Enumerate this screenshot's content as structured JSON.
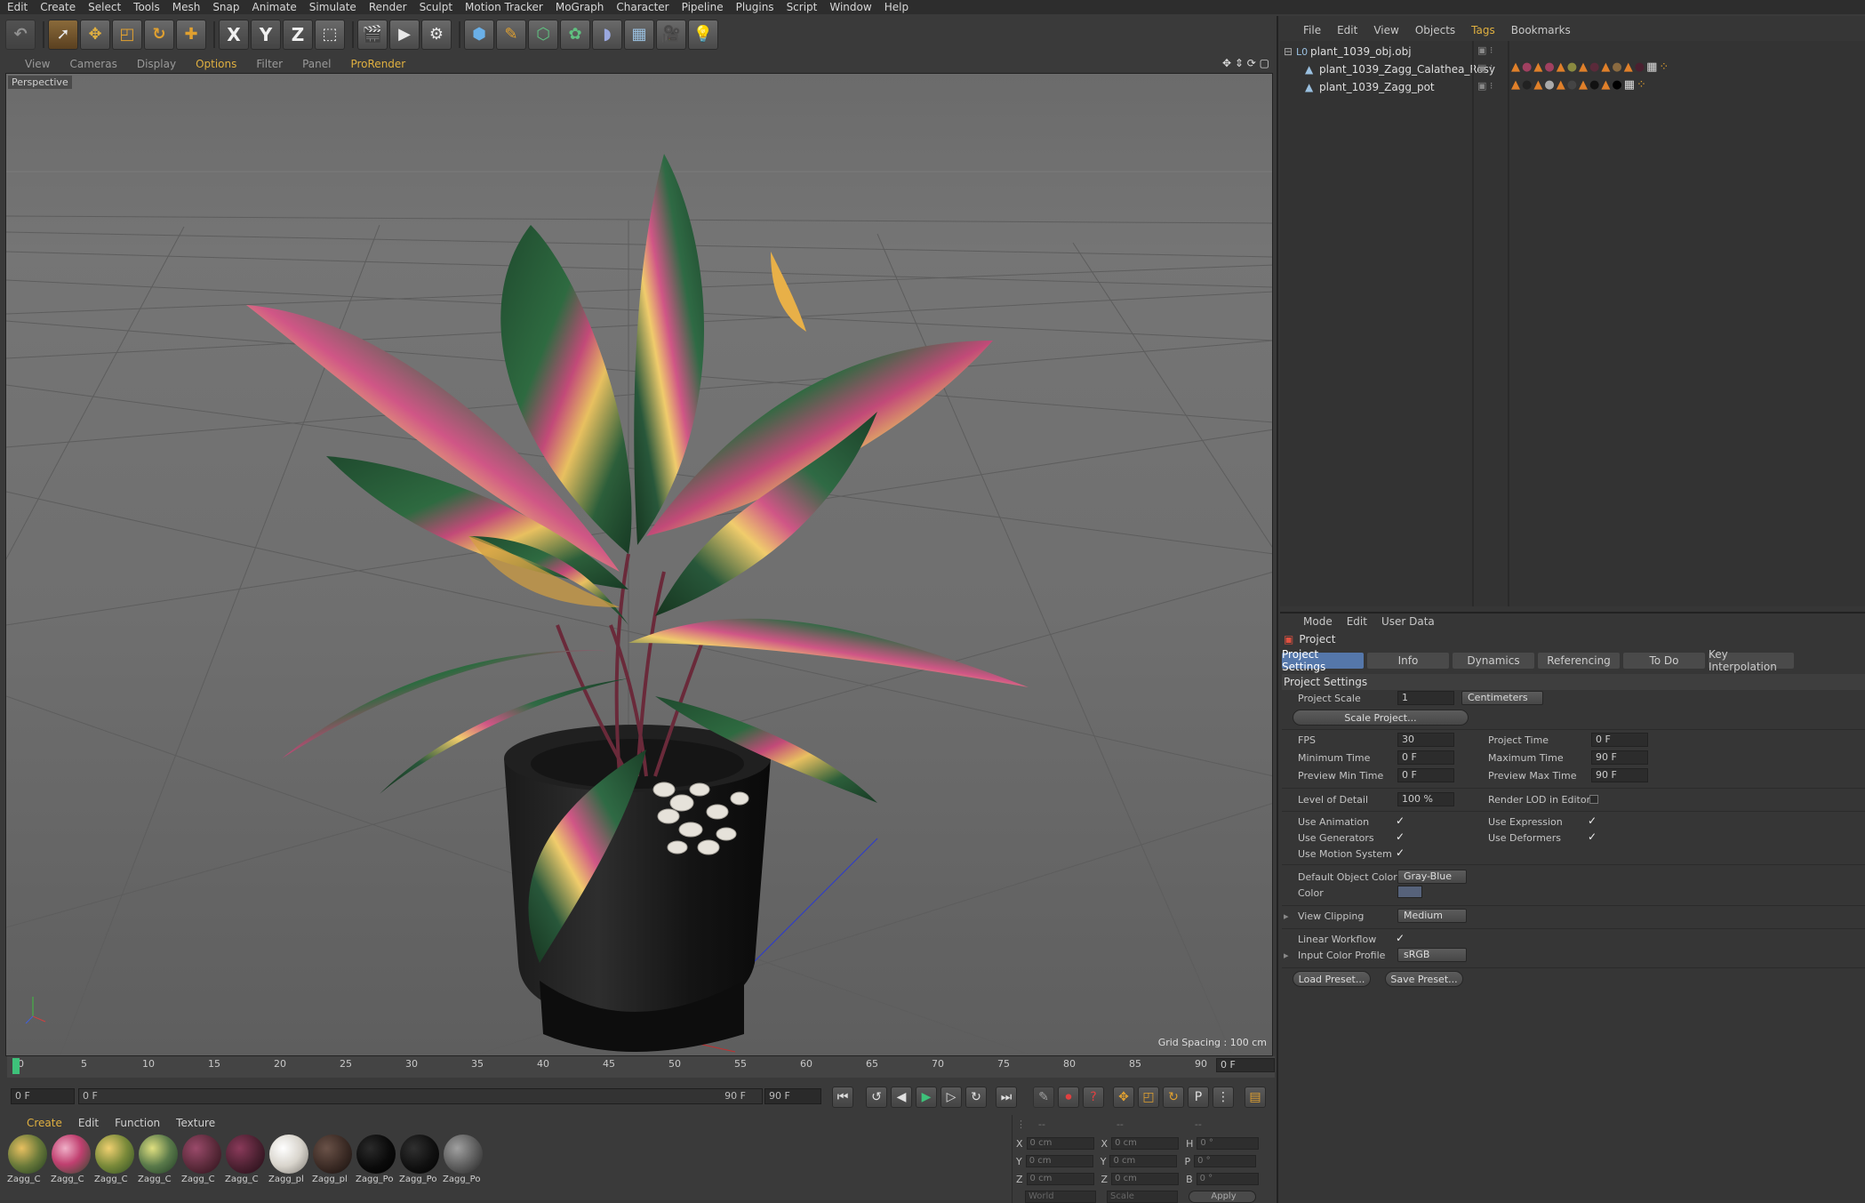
{
  "menubar": [
    "Edit",
    "Create",
    "Select",
    "Tools",
    "Mesh",
    "Snap",
    "Animate",
    "Simulate",
    "Render",
    "Sculpt",
    "Motion Tracker",
    "MoGraph",
    "Character",
    "Pipeline",
    "Plugins",
    "Script",
    "Window",
    "Help"
  ],
  "toolbar": {
    "axis_x": "X",
    "axis_y": "Y",
    "axis_z": "Z"
  },
  "viewport": {
    "menu": [
      "View",
      "Cameras",
      "Display",
      "Options",
      "Filter",
      "Panel",
      "ProRender"
    ],
    "label": "Perspective",
    "grid_spacing": "Grid Spacing : 100 cm"
  },
  "timeline": {
    "ticks": [
      "0",
      "5",
      "10",
      "15",
      "20",
      "25",
      "30",
      "35",
      "40",
      "45",
      "50",
      "55",
      "60",
      "65",
      "70",
      "75",
      "80",
      "85",
      "90"
    ],
    "current_frame": "0 F",
    "start": "0 F",
    "slider_start": "0 F",
    "slider_end": "90 F",
    "end": "90 F"
  },
  "materials": {
    "menu": [
      "Create",
      "Edit",
      "Function",
      "Texture"
    ],
    "items": [
      "Zagg_C",
      "Zagg_C",
      "Zagg_C",
      "Zagg_C",
      "Zagg_C",
      "Zagg_C",
      "Zagg_pl",
      "Zagg_pl",
      "Zagg_Po",
      "Zagg_Po",
      "Zagg_Po"
    ],
    "colors": [
      "#6a7a3a",
      "#8a3a5a",
      "#7a8a3a",
      "#5a7a4a",
      "#5a2a3a",
      "#4a2030",
      "#d8d4cc",
      "#3a2a24",
      "#0a0a0a",
      "#101010",
      "#5a5a5a"
    ]
  },
  "coords": {
    "header": [
      "--",
      "--",
      "--"
    ],
    "rows": [
      {
        "a": "X",
        "av": "0 cm",
        "b": "X",
        "bv": "0 cm",
        "c": "H",
        "cv": "0 °"
      },
      {
        "a": "Y",
        "av": "0 cm",
        "b": "Y",
        "bv": "0 cm",
        "c": "P",
        "cv": "0 °"
      },
      {
        "a": "Z",
        "av": "0 cm",
        "b": "Z",
        "bv": "0 cm",
        "c": "B",
        "cv": "0 °"
      }
    ],
    "mode": "World",
    "scale": "Scale",
    "apply": "Apply"
  },
  "objects": {
    "menu": [
      "File",
      "Edit",
      "View",
      "Objects",
      "Tags",
      "Bookmarks"
    ],
    "items": [
      "plant_1039_obj.obj",
      "plant_1039_Zagg_Calathea_Rosy",
      "plant_1039_Zagg_pot"
    ]
  },
  "attributes": {
    "menu": [
      "Mode",
      "Edit",
      "User Data"
    ],
    "title": "Project",
    "tabs": [
      "Project Settings",
      "Info",
      "Dynamics",
      "Referencing",
      "To Do",
      "Key Interpolation"
    ],
    "section": "Project Settings",
    "project_scale_label": "Project Scale",
    "project_scale_value": "1",
    "project_scale_unit": "Centimeters",
    "scale_project_btn": "Scale Project...",
    "fps_label": "FPS",
    "fps_value": "30",
    "project_time_label": "Project Time",
    "project_time_value": "0 F",
    "min_time_label": "Minimum Time",
    "min_time_value": "0 F",
    "max_time_label": "Maximum Time",
    "max_time_value": "90 F",
    "prev_min_label": "Preview Min Time",
    "prev_min_value": "0 F",
    "prev_max_label": "Preview Max Time",
    "prev_max_value": "90 F",
    "lod_label": "Level of Detail",
    "lod_value": "100 %",
    "render_lod_label": "Render LOD in Editor",
    "use_animation_label": "Use Animation",
    "use_expression_label": "Use Expression",
    "use_generators_label": "Use Generators",
    "use_deformers_label": "Use Deformers",
    "use_motion_label": "Use Motion System",
    "default_color_label": "Default Object Color",
    "default_color_value": "Gray-Blue",
    "color_label": "Color",
    "view_clipping_label": "View Clipping",
    "view_clipping_value": "Medium",
    "linear_workflow_label": "Linear Workflow",
    "input_color_label": "Input Color Profile",
    "input_color_value": "sRGB",
    "load_preset": "Load Preset...",
    "save_preset": "Save Preset...",
    "checkmark": "✓"
  },
  "colors": {
    "accent": "#e0b040",
    "tab_active": "#5577aa",
    "playhead": "#3ec27a"
  }
}
